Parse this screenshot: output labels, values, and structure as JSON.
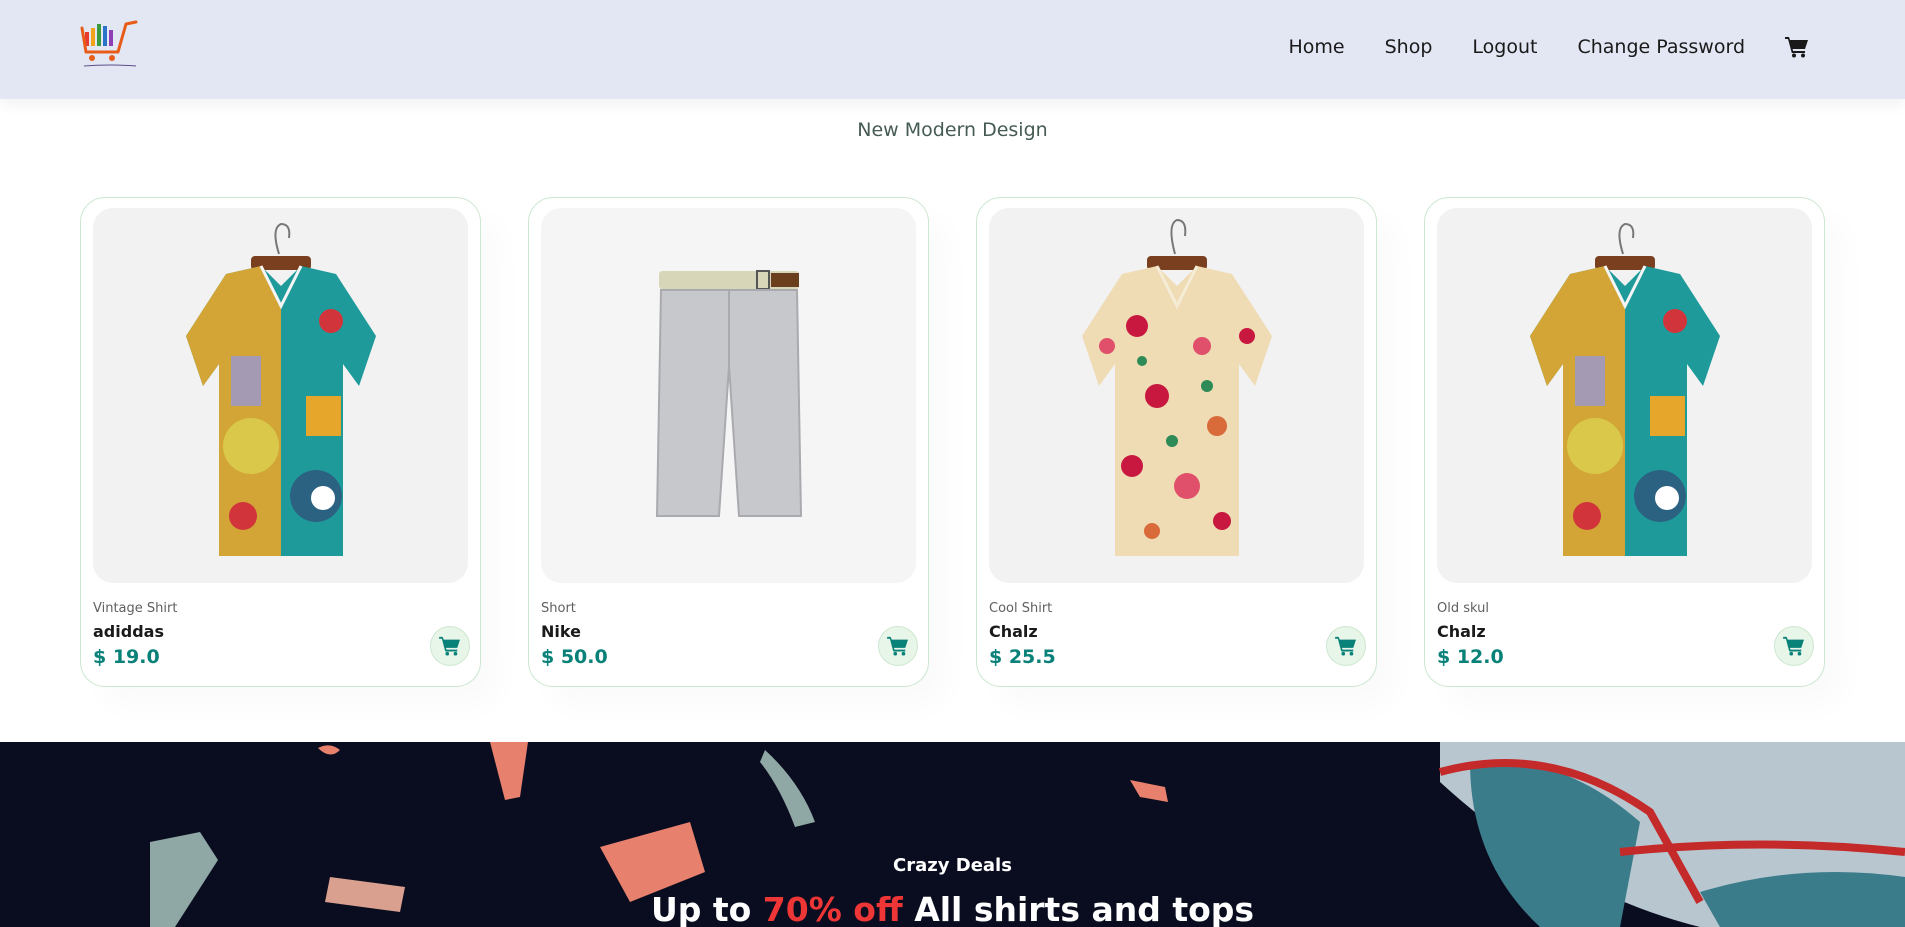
{
  "header": {
    "logo_alt": "E-Commerce Logo",
    "nav": [
      "Home",
      "Shop",
      "Logout",
      "Change Password"
    ],
    "cart_icon": "cart-icon"
  },
  "main": {
    "subtitle": "New Modern Design"
  },
  "products": [
    {
      "brand": "Vintage Shirt",
      "name": "adiddas",
      "price": "$ 19.0",
      "image": "abstract-shirt"
    },
    {
      "brand": "Short",
      "name": "Nike",
      "price": "$ 50.0",
      "image": "grey-shorts"
    },
    {
      "brand": "Cool Shirt",
      "name": "Chalz",
      "price": "$ 25.5",
      "image": "floral-shirt"
    },
    {
      "brand": "Old skul",
      "name": "Chalz",
      "price": "$ 12.0",
      "image": "abstract-shirt"
    }
  ],
  "banner": {
    "small_text": "Crazy Deals",
    "big_prefix": "Up to",
    "big_accent": "70% off",
    "big_suffix": "All shirts and tops"
  },
  "colors": {
    "header_bg": "#e3e6f3",
    "accent_green": "#088178",
    "banner_bg": "#0a0d1f",
    "sale_red": "#ef3636"
  }
}
